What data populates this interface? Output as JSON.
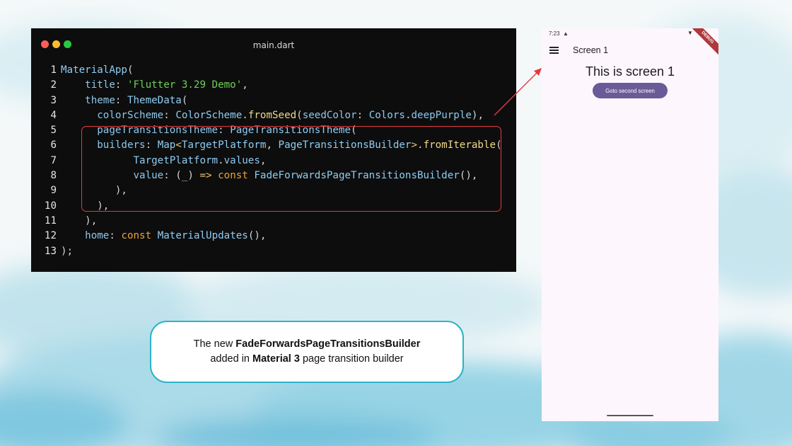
{
  "code_window": {
    "file_name": "main.dart",
    "lines": [
      {
        "n": "1",
        "tokens": [
          {
            "t": "MaterialApp",
            "c": "type"
          },
          {
            "t": "(",
            "c": "plain"
          }
        ]
      },
      {
        "n": "2",
        "tokens": [
          {
            "t": "    title",
            "c": "prop"
          },
          {
            "t": ": ",
            "c": "plain"
          },
          {
            "t": "'Flutter 3.29 Demo'",
            "c": "str"
          },
          {
            "t": ",",
            "c": "plain"
          }
        ]
      },
      {
        "n": "3",
        "tokens": [
          {
            "t": "    theme",
            "c": "prop"
          },
          {
            "t": ": ",
            "c": "plain"
          },
          {
            "t": "ThemeData",
            "c": "type"
          },
          {
            "t": "(",
            "c": "plain"
          }
        ]
      },
      {
        "n": "4",
        "tokens": [
          {
            "t": "      colorScheme",
            "c": "prop"
          },
          {
            "t": ": ",
            "c": "plain"
          },
          {
            "t": "ColorScheme",
            "c": "type"
          },
          {
            "t": ".",
            "c": "plain"
          },
          {
            "t": "fromSeed",
            "c": "method"
          },
          {
            "t": "(",
            "c": "plain"
          },
          {
            "t": "seedColor",
            "c": "prop"
          },
          {
            "t": ": ",
            "c": "plain"
          },
          {
            "t": "Colors",
            "c": "type"
          },
          {
            "t": ".",
            "c": "plain"
          },
          {
            "t": "deepPurple",
            "c": "prop"
          },
          {
            "t": "),",
            "c": "plain"
          }
        ]
      },
      {
        "n": "5",
        "tokens": [
          {
            "t": "      pageTransitionsTheme",
            "c": "prop"
          },
          {
            "t": ": ",
            "c": "plain"
          },
          {
            "t": "PageTransitionsTheme",
            "c": "type"
          },
          {
            "t": "(",
            "c": "plain"
          }
        ]
      },
      {
        "n": "6",
        "tokens": [
          {
            "t": "      builders",
            "c": "prop"
          },
          {
            "t": ": ",
            "c": "plain"
          },
          {
            "t": "Map",
            "c": "type"
          },
          {
            "t": "<",
            "c": "op"
          },
          {
            "t": "TargetPlatform",
            "c": "type"
          },
          {
            "t": ", ",
            "c": "plain"
          },
          {
            "t": "PageTransitionsBuilder",
            "c": "type"
          },
          {
            "t": ">",
            "c": "op"
          },
          {
            "t": ".",
            "c": "plain"
          },
          {
            "t": "fromIterable",
            "c": "method"
          },
          {
            "t": "(",
            "c": "plain"
          }
        ]
      },
      {
        "n": "7",
        "tokens": [
          {
            "t": "            TargetPlatform",
            "c": "type"
          },
          {
            "t": ".",
            "c": "plain"
          },
          {
            "t": "values",
            "c": "prop"
          },
          {
            "t": ",",
            "c": "plain"
          }
        ]
      },
      {
        "n": "8",
        "tokens": [
          {
            "t": "            value",
            "c": "prop"
          },
          {
            "t": ": (",
            "c": "plain"
          },
          {
            "t": "_",
            "c": "prop"
          },
          {
            "t": ") ",
            "c": "plain"
          },
          {
            "t": "=>",
            "c": "op"
          },
          {
            "t": " ",
            "c": "plain"
          },
          {
            "t": "const",
            "c": "kw"
          },
          {
            "t": " ",
            "c": "plain"
          },
          {
            "t": "FadeForwardsPageTransitionsBuilder",
            "c": "type"
          },
          {
            "t": "(),",
            "c": "plain"
          }
        ]
      },
      {
        "n": "9",
        "tokens": [
          {
            "t": "         ),",
            "c": "plain"
          }
        ]
      },
      {
        "n": "10",
        "tokens": [
          {
            "t": "      ),",
            "c": "plain"
          }
        ]
      },
      {
        "n": "11",
        "tokens": [
          {
            "t": "    ),",
            "c": "plain"
          }
        ]
      },
      {
        "n": "12",
        "tokens": [
          {
            "t": "    home",
            "c": "prop"
          },
          {
            "t": ": ",
            "c": "plain"
          },
          {
            "t": "const",
            "c": "kw"
          },
          {
            "t": " ",
            "c": "plain"
          },
          {
            "t": "MaterialUpdates",
            "c": "type"
          },
          {
            "t": "(),",
            "c": "plain"
          }
        ]
      },
      {
        "n": "13",
        "tokens": [
          {
            "t": ");",
            "c": "plain"
          }
        ]
      }
    ]
  },
  "callout": {
    "line1_prefix": "The new ",
    "line1_bold": "FadeForwardsPageTransitionsBuilder",
    "line2_prefix": "added in ",
    "line2_bold": "Material 3",
    "line2_suffix": " page transition builder"
  },
  "phone": {
    "status_time": "7:23",
    "debug_banner": "DEBUG",
    "appbar_title": "Screen 1",
    "heading": "This is screen 1",
    "button_label": "Goto second screen"
  },
  "colors": {
    "highlight": "#e8393f",
    "arrow": "#e8393f",
    "button": "#6a5a97",
    "callout_border": "#2bb3c8"
  },
  "icons": [
    "menu-icon",
    "warning-icon",
    "wifi-icon",
    "battery-icon"
  ]
}
